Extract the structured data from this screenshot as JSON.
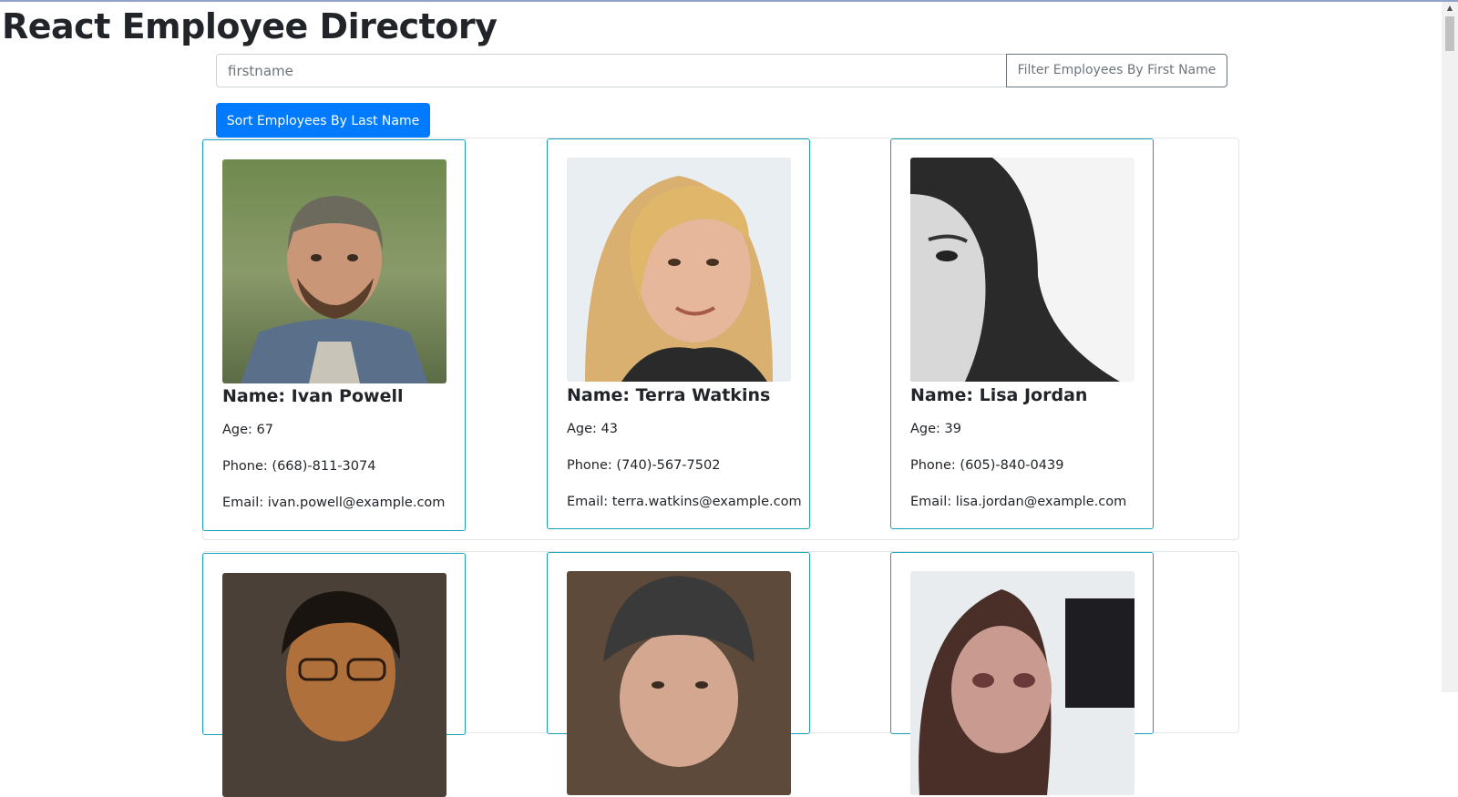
{
  "app": {
    "title": "React Employee Directory"
  },
  "filter": {
    "input_placeholder": "firstname",
    "input_value": "",
    "button_label": "Filter Employees By First Name"
  },
  "sort": {
    "button_label": "Sort Employees By Last Name"
  },
  "employees": [
    {
      "name": "Name: Ivan Powell",
      "age": "Age: 67",
      "phone": "Phone: (668)-811-3074",
      "email": "Email: ivan.powell@example.com",
      "photo_icon": "person-photo-icon"
    },
    {
      "name": "Name: Terra Watkins",
      "age": "Age: 43",
      "phone": "Phone: (740)-567-7502",
      "email": "Email: terra.watkins@example.com",
      "photo_icon": "person-photo-icon"
    },
    {
      "name": "Name: Lisa Jordan",
      "age": "Age: 39",
      "phone": "Phone: (605)-840-0439",
      "email": "Email: lisa.jordan@example.com",
      "photo_icon": "person-photo-icon"
    },
    {
      "photo_icon": "person-photo-icon"
    },
    {
      "photo_icon": "person-photo-icon"
    },
    {
      "photo_icon": "person-photo-icon"
    }
  ],
  "colors": {
    "primary_button": "#007bff",
    "card_border": "#17a2b8",
    "filter_button_border": "#6c757d"
  }
}
